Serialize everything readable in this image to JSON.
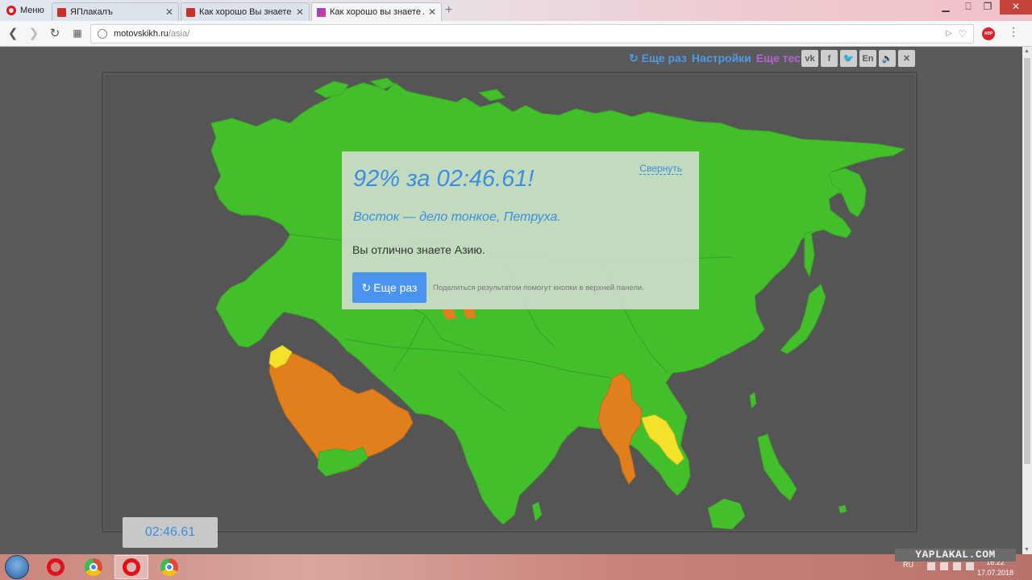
{
  "browser": {
    "menu_label": "Меню",
    "tabs": [
      {
        "title": "ЯПлакалъ",
        "active": false
      },
      {
        "title": "Как хорошо Вы знаете ка",
        "active": false
      },
      {
        "title": "Как хорошо вы знаете Аз",
        "active": true
      }
    ],
    "url_domain": "motovskikh.ru",
    "url_path": "/asia/"
  },
  "page": {
    "top_links": {
      "retry": "Еще раз",
      "settings": "Настройки",
      "more_tests": "Еще тесты"
    },
    "socials": [
      "vk-icon",
      "facebook-icon",
      "twitter-icon",
      "En",
      "sound-icon",
      "close-icon"
    ],
    "result": {
      "title": "92% за 02:46.61!",
      "subtitle": "Восток — дело тонкое, Петруха.",
      "text": "Вы отлично знаете Азию.",
      "collapse": "Свернуть",
      "button": "Еще раз",
      "note": "Поделиться результатом помогут кнопки в верхней панели."
    },
    "timer": "02:46.61",
    "map_colors": {
      "correct": "#44bf2c",
      "wrong": "#e07f1c",
      "partial": "#f4e22a",
      "ocean": "#555555"
    }
  },
  "taskbar": {
    "lang": "RU",
    "time": "16:22",
    "date": "17.07.2018"
  },
  "watermark": "YAPLAKAL.COM"
}
